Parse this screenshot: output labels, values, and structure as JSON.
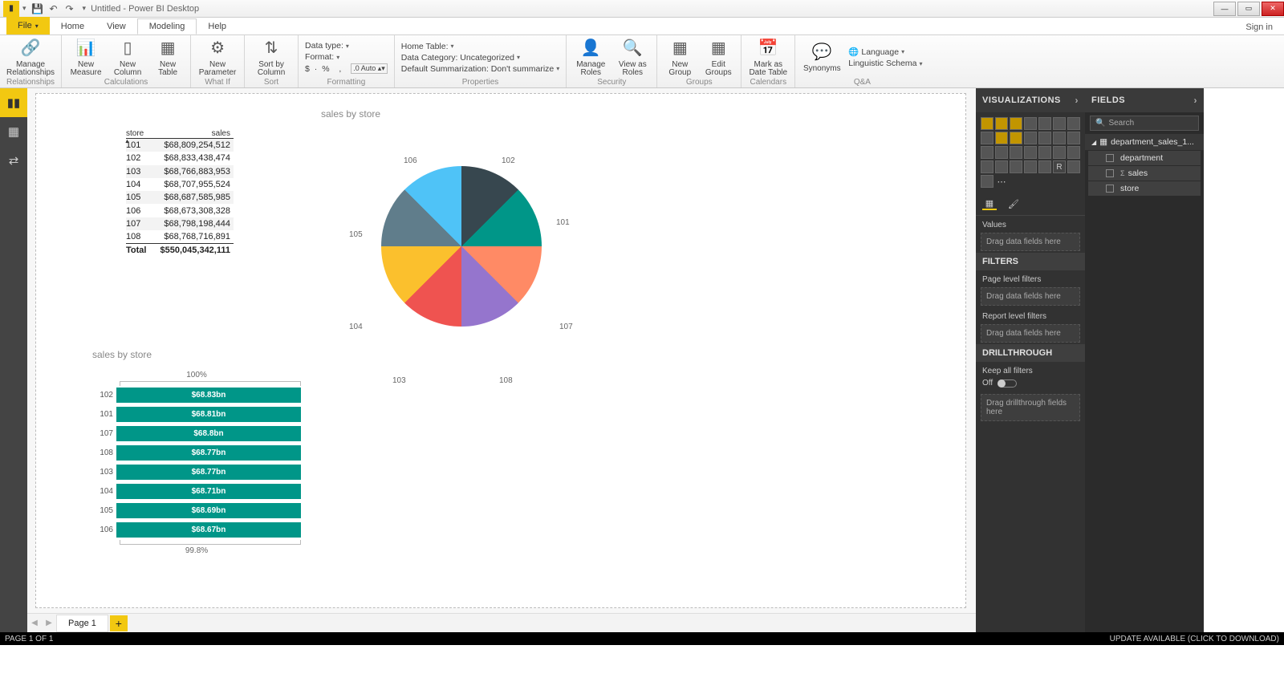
{
  "title": "Untitled - Power BI Desktop",
  "signin": "Sign in",
  "tabs": {
    "file": "File",
    "home": "Home",
    "view": "View",
    "modeling": "Modeling",
    "help": "Help"
  },
  "ribbon": {
    "manage_rel": "Manage\nRelationships",
    "relationships": "Relationships",
    "new_measure": "New\nMeasure",
    "new_column": "New\nColumn",
    "new_table": "New\nTable",
    "calculations": "Calculations",
    "new_param": "New\nParameter",
    "whatif": "What If",
    "sort_by": "Sort by\nColumn",
    "sort": "Sort",
    "data_type": "Data type:",
    "format": "Format:",
    "auto": "Auto",
    "formatting": "Formatting",
    "currency": "$",
    "pct": "%",
    "comma": ",",
    "home_table": "Home Table:",
    "data_cat": "Data Category: Uncategorized",
    "def_sum": "Default Summarization: Don't summarize",
    "properties": "Properties",
    "manage_roles": "Manage\nRoles",
    "view_as": "View as\nRoles",
    "security": "Security",
    "new_group": "New\nGroup",
    "edit_groups": "Edit\nGroups",
    "groups": "Groups",
    "mark_as": "Mark as\nDate Table",
    "calendars": "Calendars",
    "synonyms": "Synonyms",
    "language": "Language",
    "ling": "Linguistic Schema",
    "qa": "Q&A"
  },
  "vis_pane": {
    "title": "VISUALIZATIONS",
    "values": "Values",
    "drag": "Drag data fields here",
    "filters": "FILTERS",
    "page_f": "Page level filters",
    "report_f": "Report level filters",
    "drill": "DRILLTHROUGH",
    "keep": "Keep all filters",
    "off": "Off",
    "drag_drill": "Drag drillthrough fields here"
  },
  "fields_pane": {
    "title": "FIELDS",
    "search": "Search",
    "table": "department_sales_1...",
    "cols": [
      "department",
      "sales",
      "store"
    ]
  },
  "page": {
    "tab": "Page 1",
    "status": "PAGE 1 OF 1",
    "update": "UPDATE AVAILABLE (CLICK TO DOWNLOAD)"
  },
  "chart_data": {
    "table": {
      "title": "sales by store",
      "columns": [
        "store",
        "sales"
      ],
      "rows": [
        [
          "101",
          "$68,809,254,512"
        ],
        [
          "102",
          "$68,833,438,474"
        ],
        [
          "103",
          "$68,766,883,953"
        ],
        [
          "104",
          "$68,707,955,524"
        ],
        [
          "105",
          "$68,687,585,985"
        ],
        [
          "106",
          "$68,673,308,328"
        ],
        [
          "107",
          "$68,798,198,444"
        ],
        [
          "108",
          "$68,768,716,891"
        ]
      ],
      "total": [
        "Total",
        "$550,045,342,111"
      ]
    },
    "pie": {
      "type": "pie",
      "title": "sales by store",
      "categories": [
        "101",
        "102",
        "103",
        "104",
        "105",
        "106",
        "107",
        "108"
      ],
      "values": [
        68809254512,
        68833438474,
        68766883953,
        68707955524,
        68687585985,
        68673308328,
        68798198444,
        68768716891
      ]
    },
    "bars": {
      "type": "bar",
      "title": "sales by store",
      "top_label": "100%",
      "bottom_label": "99.8%",
      "categories": [
        "102",
        "101",
        "107",
        "108",
        "103",
        "104",
        "105",
        "106"
      ],
      "labels": [
        "$68.83bn",
        "$68.81bn",
        "$68.8bn",
        "$68.77bn",
        "$68.77bn",
        "$68.71bn",
        "$68.69bn",
        "$68.67bn"
      ],
      "widths_pct": [
        100,
        99.97,
        99.95,
        99.91,
        99.9,
        99.82,
        99.79,
        99.77
      ]
    }
  }
}
